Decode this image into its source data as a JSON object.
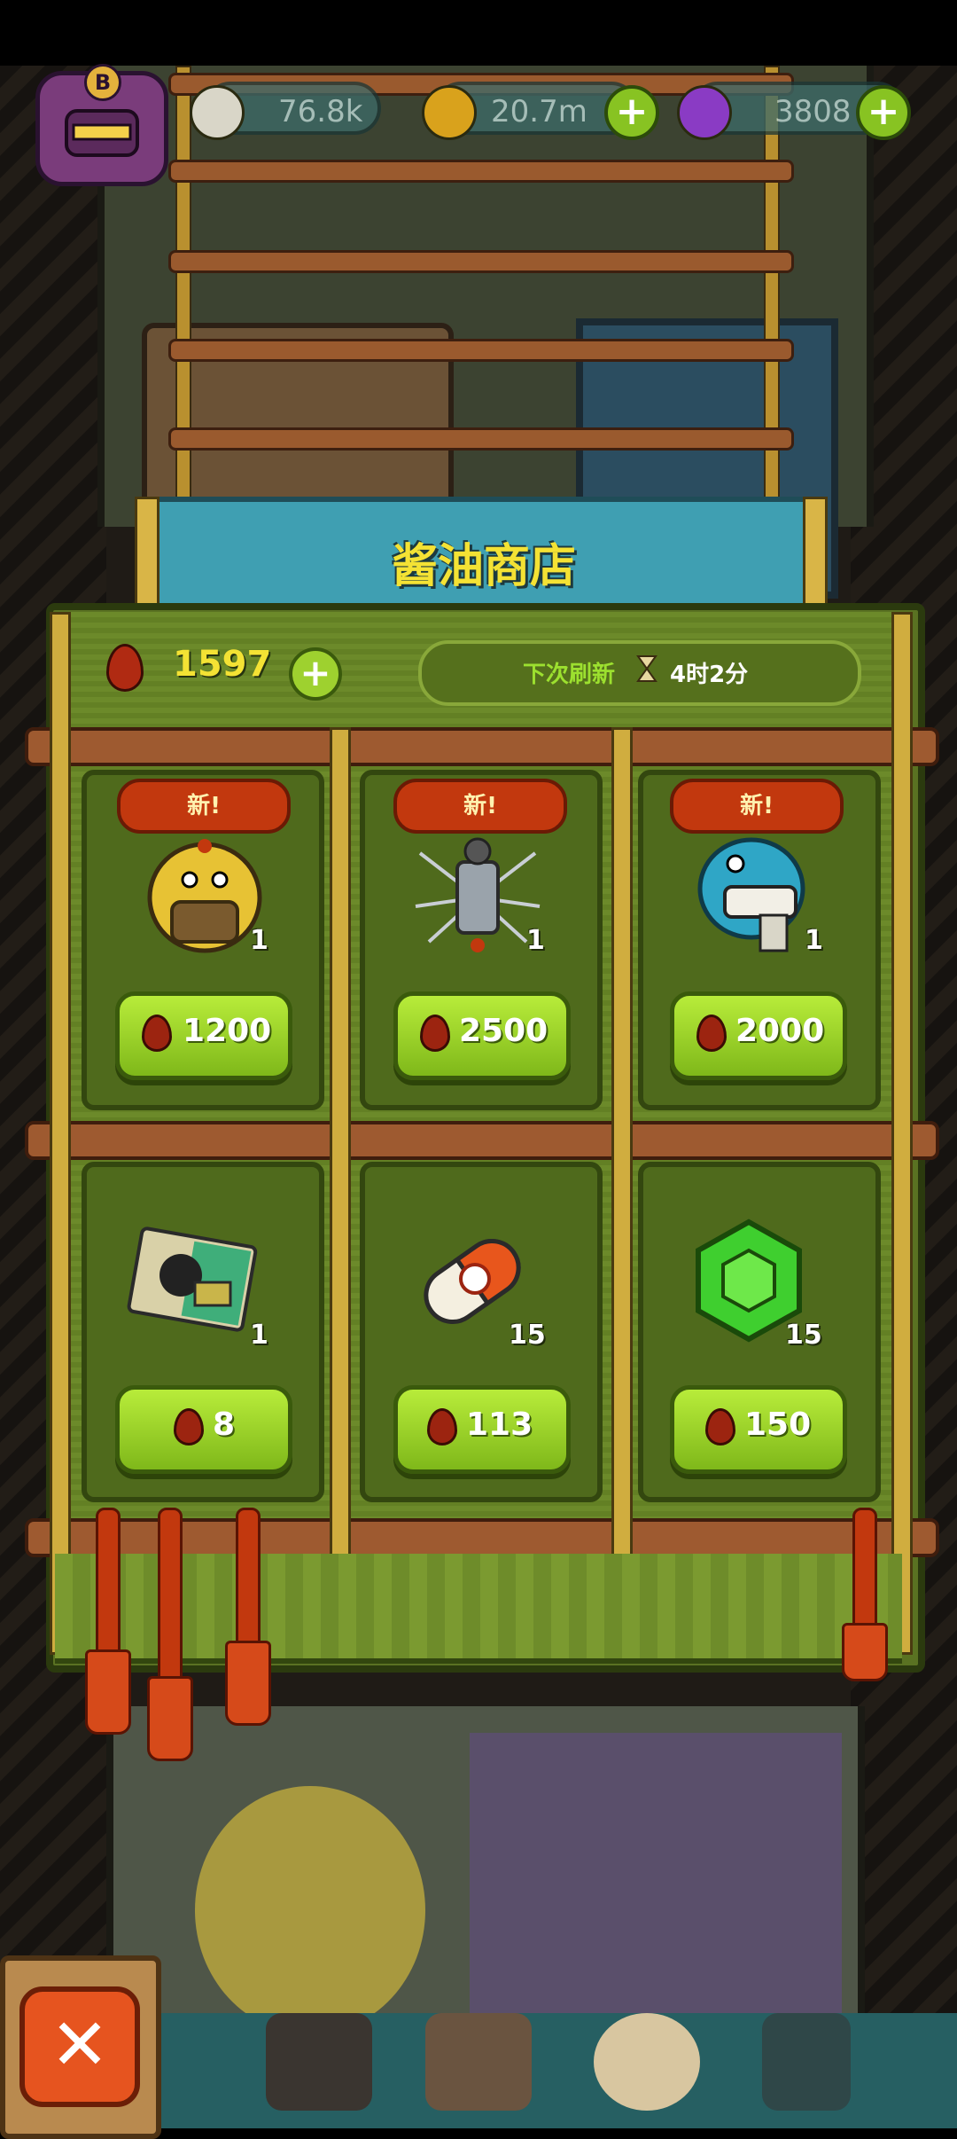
{
  "hud": {
    "eye_count": "76.8k",
    "coin_count": "20.7m",
    "potion_count": "3808",
    "avatar_badge": "B"
  },
  "shop": {
    "title": "酱油商店",
    "balance": "1597",
    "refresh_label": "下次刷新",
    "refresh_time": "4时2分",
    "new_badge": "新!",
    "items": [
      {
        "name": "yellow-fluffy-monster",
        "qty": "1",
        "price": "1200",
        "is_new": true
      },
      {
        "name": "gray-skeleton-monster",
        "qty": "1",
        "price": "2500",
        "is_new": true
      },
      {
        "name": "blue-toothy-monster",
        "qty": "1",
        "price": "2000",
        "is_new": true
      },
      {
        "name": "crow-map-card",
        "qty": "1",
        "price": "8",
        "is_new": false
      },
      {
        "name": "orange-capsule",
        "qty": "15",
        "price": "113",
        "is_new": false
      },
      {
        "name": "green-gem",
        "qty": "15",
        "price": "150",
        "is_new": false
      }
    ]
  },
  "nav": {
    "close_label": "✕"
  },
  "colors": {
    "gold_text": "#f4e234",
    "price_button": "#9ed12f",
    "new_badge": "#c2380e",
    "panel_green": "#5a7222"
  }
}
